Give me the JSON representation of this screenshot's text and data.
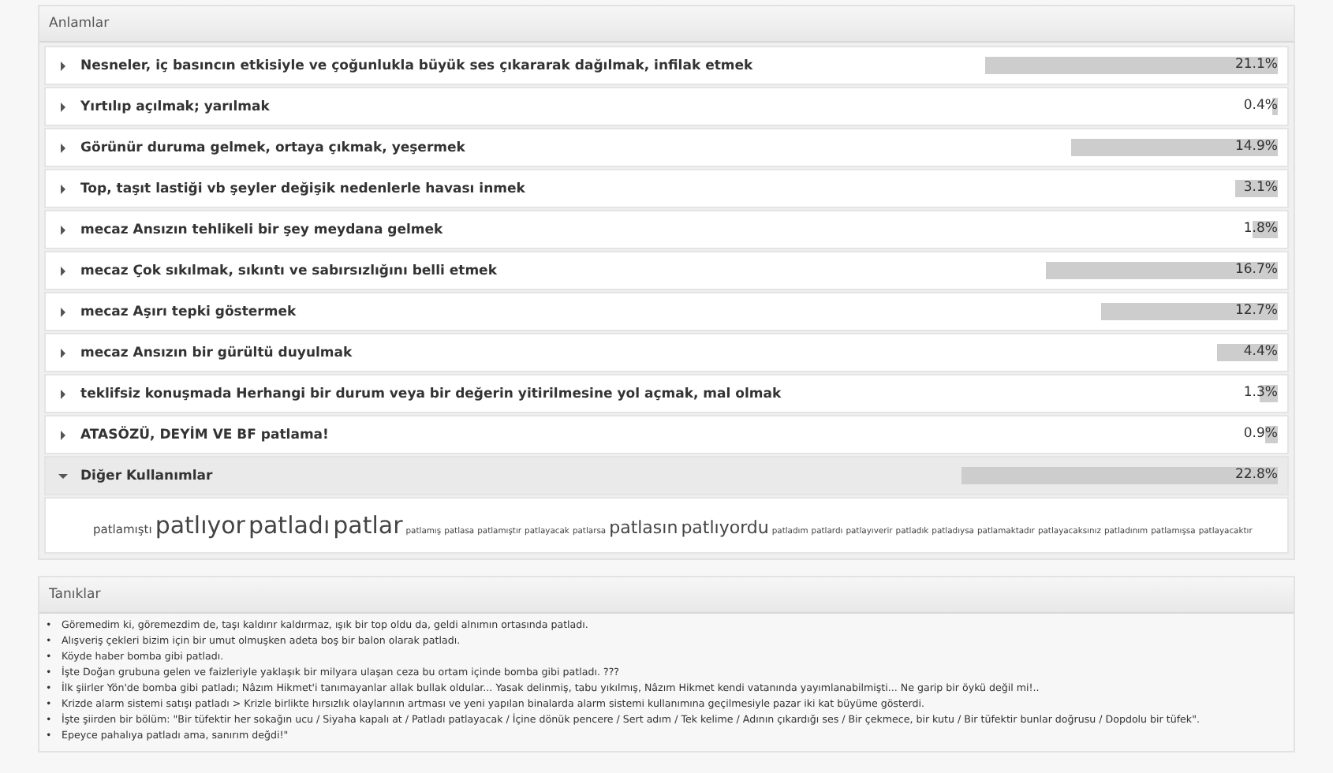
{
  "meanings": {
    "title": "Anlamlar",
    "rows": [
      {
        "text": "Nesneler, iç basıncın etkisiyle ve çoğunlukla büyük ses çıkararak dağılmak, infilak etmek",
        "percent": "21.1%",
        "expanded": false
      },
      {
        "text": "Yırtılıp açılmak; yarılmak",
        "percent": "0.4%",
        "expanded": false
      },
      {
        "text": "Görünür duruma gelmek, ortaya çıkmak, yeşermek",
        "percent": "14.9%",
        "expanded": false
      },
      {
        "text": "Top, taşıt lastiği vb şeyler değişik nedenlerle havası inmek",
        "percent": "3.1%",
        "expanded": false
      },
      {
        "text": "mecaz Ansızın tehlikeli bir şey meydana gelmek",
        "percent": "1.8%",
        "expanded": false
      },
      {
        "text": "mecaz Çok sıkılmak, sıkıntı ve sabırsızlığını belli etmek",
        "percent": "16.7%",
        "expanded": false
      },
      {
        "text": "mecaz Aşırı tepki göstermek",
        "percent": "12.7%",
        "expanded": false
      },
      {
        "text": "mecaz Ansızın bir gürültü duyulmak",
        "percent": "4.4%",
        "expanded": false
      },
      {
        "text": "teklifsiz konuşmada Herhangi bir durum veya bir değerin yitirilmesine yol açmak, mal olmak",
        "percent": "1.3%",
        "expanded": false
      },
      {
        "text": "ATASÖZÜ, DEYİM VE BF patlama!",
        "percent": "0.9%",
        "expanded": false
      },
      {
        "text": "Diğer Kullanımlar",
        "percent": "22.8%",
        "expanded": true
      }
    ],
    "words": [
      {
        "text": "patlamıştı",
        "kind": "small"
      },
      {
        "text": "patlıyor",
        "kind": "large"
      },
      {
        "text": "patladı",
        "kind": "large"
      },
      {
        "text": "patlar",
        "kind": "large"
      },
      {
        "text": "patlamış",
        "kind": "tiny"
      },
      {
        "text": "patlasa",
        "kind": "tiny"
      },
      {
        "text": "patlamıştır",
        "kind": "tiny"
      },
      {
        "text": "patlayacak",
        "kind": "tiny"
      },
      {
        "text": "patlarsa",
        "kind": "tiny"
      },
      {
        "text": "patlasın",
        "kind": "medium"
      },
      {
        "text": "patlıyordu",
        "kind": "medium"
      },
      {
        "text": "patladım",
        "kind": "tiny"
      },
      {
        "text": "patlardı",
        "kind": "tiny"
      },
      {
        "text": "patlayıverir",
        "kind": "tiny"
      },
      {
        "text": "patladık",
        "kind": "tiny"
      },
      {
        "text": "patladıysa",
        "kind": "tiny"
      },
      {
        "text": "patlamaktadır",
        "kind": "tiny"
      },
      {
        "text": "patlayacaksınız",
        "kind": "tiny"
      },
      {
        "text": "patladınım",
        "kind": "tiny"
      },
      {
        "text": "patlamışsa",
        "kind": "tiny"
      },
      {
        "text": "patlayacaktır",
        "kind": "tiny"
      }
    ]
  },
  "examples": {
    "title": "Tanıklar",
    "items": [
      {
        "bullet": "•",
        "text": "Göremedim ki, göremezdim de, taşı kaldırır kaldırmaz, ışık bir top oldu da, geldi alnımın ortasında patladı."
      },
      {
        "bullet": "•",
        "text": "Alışveriş çekleri bizim için bir umut olmuşken adeta boş bir balon olarak patladı."
      },
      {
        "bullet": "•",
        "text": "Köyde haber bomba gibi patladı."
      },
      {
        "bullet": "•",
        "text": "İşte Doğan grubuna gelen ve faizleriyle yaklaşık bir milyara ulaşan ceza bu ortam içinde bomba gibi patladı. ???"
      },
      {
        "bullet": "•",
        "text": "İlk şiirler Yön'de bomba gibi patladı; Nâzım Hikmet'i tanımayanlar allak bullak oldular... Yasak delinmiş, tabu yıkılmış, Nâzım Hikmet kendi vatanında yayımlanabilmişti... Ne garip bir öykü değil mi!.."
      },
      {
        "bullet": "•",
        "text": "Krizde alarm sistemi satışı patladı > Krizle birlikte hırsızlık olaylarının artması ve yeni yapılan binalarda alarm sistemi kullanımına geçilmesiyle pazar iki kat büyüme gösterdi."
      },
      {
        "bullet": "•",
        "text": "İşte şiirden bir bölüm: \"Bir tüfektir her sokağın ucu / Siyaha kapalı at / Patladı patlayacak / İçine dönük pencere / Sert adım / Tek kelime / Adının çıkardığı ses / Bir çekmece, bir kutu / Bir tüfektir bunlar doğrusu / Dopdolu bir tüfek\"."
      },
      {
        "bullet": "•",
        "text": "Epeyce pahalıya patladı ama, sanırım değdi!\""
      }
    ]
  }
}
